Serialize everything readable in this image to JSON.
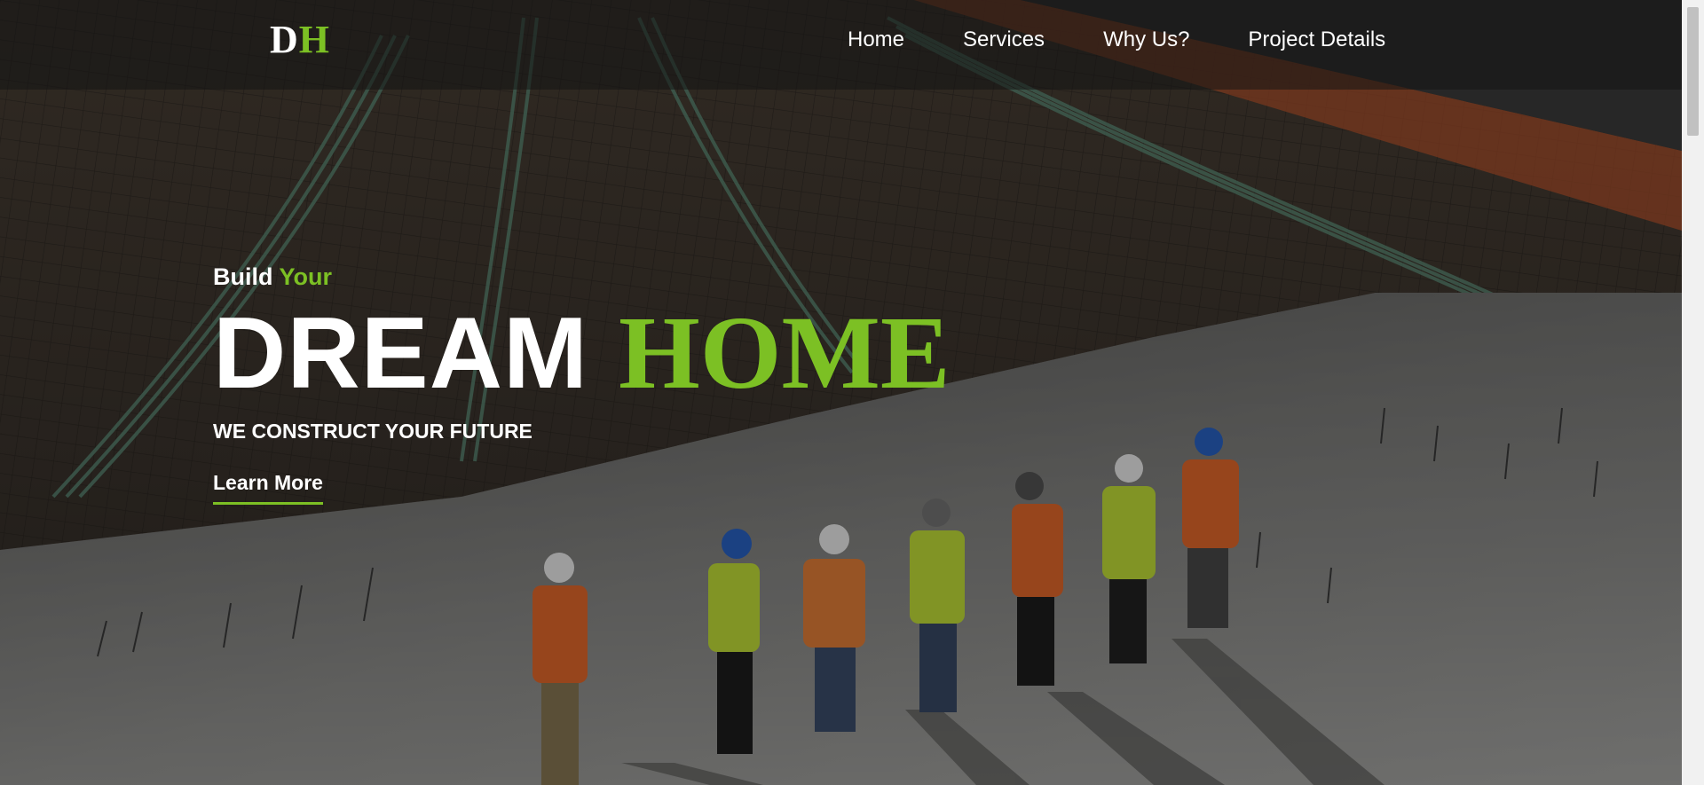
{
  "brand": {
    "logo_first": "D",
    "logo_second": "H",
    "accent_color": "#7cc024"
  },
  "nav": {
    "items": [
      {
        "label": "Home"
      },
      {
        "label": "Services"
      },
      {
        "label": "Why Us?"
      },
      {
        "label": "Project Details"
      }
    ]
  },
  "hero": {
    "tagline_prefix": "Build",
    "tagline_accent": "Your",
    "headline_white": "DREAM",
    "headline_green": "HOME",
    "subline": "WE CONSTRUCT YOUR FUTURE",
    "cta_label": "Learn More",
    "background_image": "construction-site-workers-photo"
  }
}
